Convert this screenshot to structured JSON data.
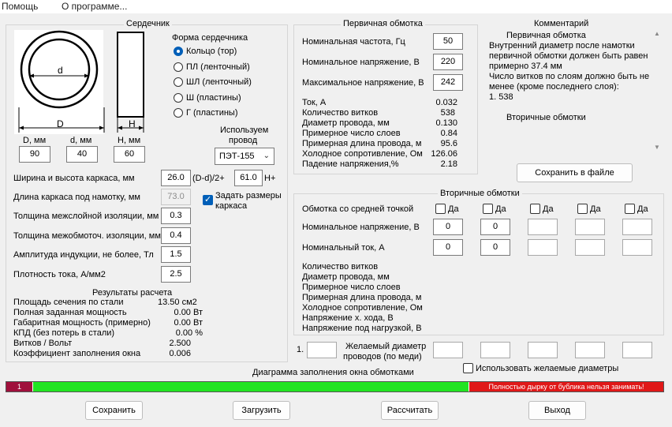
{
  "menu": {
    "help": "Помощь",
    "about": "О программе..."
  },
  "core": {
    "title": "Сердечник",
    "label_d": "d",
    "label_D": "D",
    "label_H": "H",
    "shape_title": "Форма сердечника",
    "shapes": [
      "Кольцо  (тор)",
      "ПЛ  (ленточный)",
      "ШЛ  (ленточный)",
      "Ш  (пластины)",
      "Г  (пластины)"
    ],
    "cols": [
      "D, мм",
      "d, мм",
      "H, мм"
    ],
    "vals": [
      "90",
      "40",
      "60"
    ],
    "wire_label_1": "Используем",
    "wire_label_2": "провод",
    "wire_value": "ПЭТ-155",
    "frame_wh_label": "Ширина и высота каркаса, мм",
    "frame_w": "26.0",
    "frame_mid": "(D-d)/2+",
    "frame_h": "61.0",
    "frame_suffix": "H+",
    "frame_len_label": "Длина каркаса под намотку, мм",
    "frame_len": "73.0",
    "set_dims_1": "Задать размеры",
    "set_dims_2": "каркаса",
    "interlayer_label": "Толщина межслойной изоляции, мм",
    "interlayer": "0.3",
    "interwinding_label": "Толщина межобмоточ. изоляции, мм",
    "interwinding": "0.4",
    "induction_label": "Амплитуда индукции, не более, Тл",
    "induction": "1.5",
    "current_density_label": "Плотность тока, А/мм2",
    "current_density": "2.5"
  },
  "results": {
    "title": "Результаты расчета",
    "rows": [
      {
        "label": "Площадь сечения по стали",
        "value": "13.50 см2"
      },
      {
        "label": "Полная заданная мощность",
        "value": "0.00 Вт"
      },
      {
        "label": "Габаритная мощность (примерно)",
        "value": "0.00 Вт"
      },
      {
        "label": "КПД (без потерь в стали)",
        "value": "0.00 %"
      },
      {
        "label": "Витков / Вольт",
        "value": "2.500"
      },
      {
        "label": "Коэффициент заполнения окна",
        "value": "0.006"
      }
    ]
  },
  "primary": {
    "title": "Первичная обмотка",
    "freq_label": "Номинальная частота, Гц",
    "freq": "50",
    "volt_label": "Номинальное напряжение, В",
    "volt": "220",
    "max_volt_label": "Максимальное напряжение, В",
    "max_volt": "242",
    "rows": [
      {
        "label": "Ток, А",
        "value": "0.032"
      },
      {
        "label": "Количество витков",
        "value": "538"
      },
      {
        "label": "Диаметр провода, мм",
        "value": "0.130"
      },
      {
        "label": "Примерное число слоев",
        "value": "0.84"
      },
      {
        "label": "Примерная длина провода, м",
        "value": "95.6"
      },
      {
        "label": "Холодное сопротивление, Ом",
        "value": "126.06"
      },
      {
        "label": "Падение напряжения,%",
        "value": "2.18"
      }
    ]
  },
  "comment": {
    "title": "Комментарий",
    "heading1": "Первичная обмотка",
    "lines": [
      "Внутренний диаметр после намотки",
      "первичной обмотки должен быть равен",
      "примерно 37.4 мм",
      "Число витков по слоям должно быть не",
      "менее (кроме последнего слоя):",
      "1. 538"
    ],
    "heading2": "Вторичные обмотки",
    "save_button": "Сохранить в файле"
  },
  "secondary": {
    "title": "Вторичные обмотки",
    "center_tap_label": "Обмотка со средней точкой",
    "yes_label": "Да",
    "volt_label": "Номинальное напряжение, В",
    "current_label": "Номинальный ток, А",
    "volts": [
      "0",
      "0",
      "",
      "",
      ""
    ],
    "currents": [
      "0",
      "0",
      "",
      "",
      ""
    ],
    "info_rows": [
      "Количество витков",
      "Диаметр провода, мм",
      "Примерное число слоев",
      "Примерная длина провода, м",
      "Холодное сопротивление, Ом",
      "Напряжение х. хода, В",
      "Напряжение под нагрузкой, В"
    ],
    "desired_index": "1.",
    "desired_label_1": "Желаемый диаметр",
    "desired_label_2": "проводов  (по меди)",
    "use_desired_label": "Использовать желаемые диаметры"
  },
  "fill": {
    "title": "Диаграмма заполнения окна обмотками",
    "marker": "1",
    "warning": "Полностью дырку от бублика нельзя занимать!",
    "colors": {
      "marker": "#a0103c",
      "fill": "#22e422",
      "warning": "#e01818"
    }
  },
  "buttons": {
    "save": "Сохранить",
    "load": "Загрузить",
    "calc": "Рассчитать",
    "exit": "Выход"
  }
}
